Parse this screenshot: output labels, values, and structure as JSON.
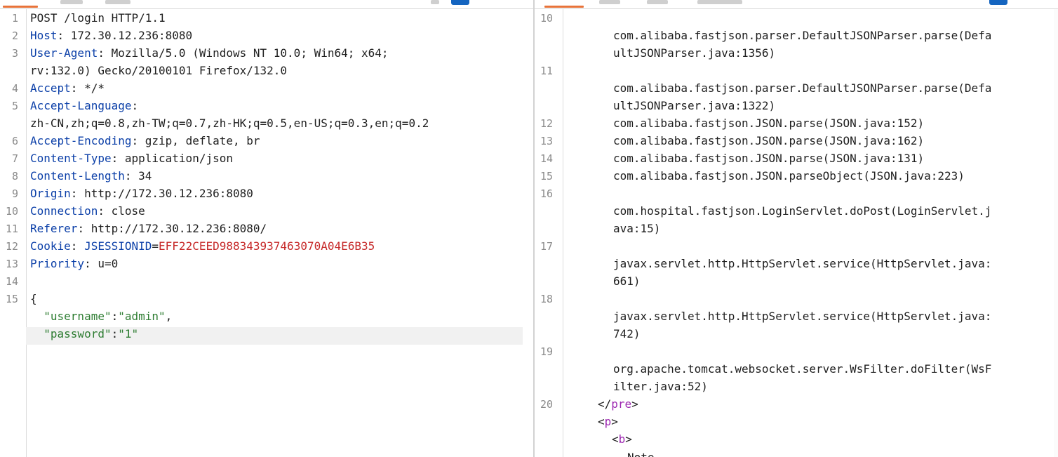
{
  "request": {
    "line_numbers": [
      "1",
      "2",
      "3",
      "4",
      "5",
      "6",
      "7",
      "8",
      "9",
      "10",
      "11",
      "12",
      "13",
      "14",
      "15"
    ],
    "request_line": "POST /login HTTP/1.1",
    "headers": {
      "host_key": "Host",
      "host_value": "172.30.12.236:8080",
      "ua_key": "User-Agent",
      "ua_value_1": "Mozilla/5.0 (Windows NT 10.0; Win64; x64;",
      "ua_value_2": "rv:132.0) Gecko/20100101 Firefox/132.0",
      "accept_key": "Accept",
      "accept_value": "*/*",
      "lang_key": "Accept-Language",
      "lang_value": "zh-CN,zh;q=0.8,zh-TW;q=0.7,zh-HK;q=0.5,en-US;q=0.3,en;q=0.2",
      "enc_key": "Accept-Encoding",
      "enc_value": "gzip, deflate, br",
      "ctype_key": "Content-Type",
      "ctype_value": "application/json",
      "clen_key": "Content-Length",
      "clen_value": "34",
      "origin_key": "Origin",
      "origin_value": "http://172.30.12.236:8080",
      "conn_key": "Connection",
      "conn_value": "close",
      "referer_key": "Referer",
      "referer_value": "http://172.30.12.236:8080/",
      "cookie_key": "Cookie",
      "cookie_name": "JSESSIONID",
      "cookie_value": "EFF22CEED988343937463070A04E6B35",
      "priority_key": "Priority",
      "priority_value": "u=0"
    },
    "body": {
      "open": "{",
      "username_key": "\"username\"",
      "username_value": "\"admin\"",
      "password_key": "\"password\"",
      "password_value": "\"1\""
    }
  },
  "response": {
    "line_numbers": [
      "10",
      "11",
      "12",
      "13",
      "14",
      "15",
      "16",
      "17",
      "18",
      "19",
      "20"
    ],
    "lines": {
      "l10a": "com.alibaba.fastjson.parser.DefaultJSONParser.parse(Defa",
      "l10b": "ultJSONParser.java:1356)",
      "l11a": "com.alibaba.fastjson.parser.DefaultJSONParser.parse(Defa",
      "l11b": "ultJSONParser.java:1322)",
      "l12": "com.alibaba.fastjson.JSON.parse(JSON.java:152)",
      "l13": "com.alibaba.fastjson.JSON.parse(JSON.java:162)",
      "l14": "com.alibaba.fastjson.JSON.parse(JSON.java:131)",
      "l15": "com.alibaba.fastjson.JSON.parseObject(JSON.java:223)",
      "l16a": "com.hospital.fastjson.LoginServlet.doPost(LoginServlet.j",
      "l16b": "ava:15)",
      "l17a": "javax.servlet.http.HttpServlet.service(HttpServlet.java:",
      "l17b": "661)",
      "l18a": "javax.servlet.http.HttpServlet.service(HttpServlet.java:",
      "l18b": "742)",
      "l19a": "org.apache.tomcat.websocket.server.WsFilter.doFilter(WsF",
      "l19b": "ilter.java:52)",
      "pre_tag": "pre",
      "p_tag": "p",
      "b_tag": "b",
      "partial": "Note"
    }
  },
  "colors": {
    "accent_tab": "#e8733a",
    "header_key": "#0b3fa8",
    "cookie_value": "#c62828",
    "json_string": "#2e7d32",
    "html_tag": "#9c27b0"
  }
}
